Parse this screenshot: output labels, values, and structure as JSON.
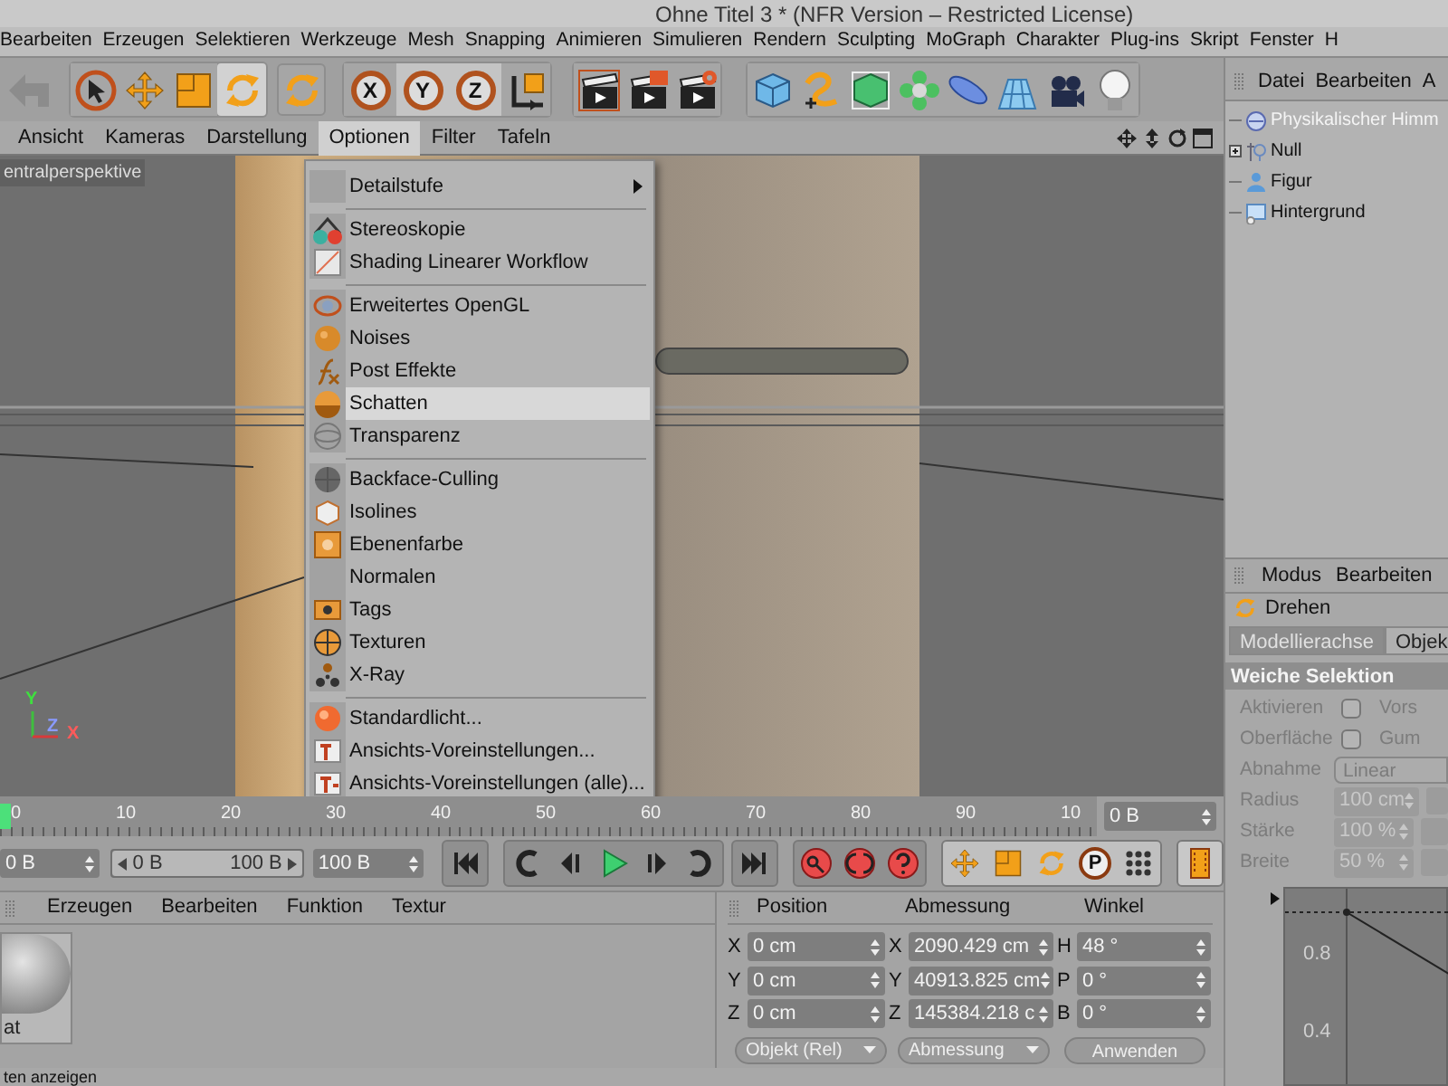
{
  "window": {
    "title": "Ohne Titel 3 * (NFR Version – Restricted License)"
  },
  "menubar": [
    "Bearbeiten",
    "Erzeugen",
    "Selektieren",
    "Werkzeuge",
    "Mesh",
    "Snapping",
    "Animieren",
    "Simulieren",
    "Rendern",
    "Sculpting",
    "MoGraph",
    "Charakter",
    "Plug-ins",
    "Skript",
    "Fenster",
    "H"
  ],
  "toolbar": {
    "tools": [
      {
        "selected": false
      },
      {
        "selected": false
      },
      {
        "selected": false
      },
      {
        "selected": true
      }
    ],
    "axis_locks": [
      {
        "label": "X",
        "on": false
      },
      {
        "label": "Y",
        "on": true
      },
      {
        "label": "Z",
        "on": true
      }
    ]
  },
  "viewport": {
    "menu": [
      {
        "label": "Ansicht",
        "selected": false
      },
      {
        "label": "Kameras",
        "selected": false
      },
      {
        "label": "Darstellung",
        "selected": false
      },
      {
        "label": "Optionen",
        "selected": true
      },
      {
        "label": "Filter",
        "selected": false
      },
      {
        "label": "Tafeln",
        "selected": false
      }
    ],
    "camera_label": "entralperspektive",
    "axes": [
      {
        "label": "Y",
        "color": "#3fdf3f"
      },
      {
        "label": "Z",
        "color": "#8a9aff"
      },
      {
        "label": "X",
        "color": "#ff5a5a"
      }
    ]
  },
  "options_menu": {
    "groups": [
      [
        {
          "label": "Detailstufe",
          "has_submenu": true,
          "selected": false
        }
      ],
      [
        {
          "label": "Stereoskopie",
          "selected": false
        },
        {
          "label": "Shading Linearer Workflow",
          "selected": false
        }
      ],
      [
        {
          "label": "Erweitertes OpenGL",
          "selected": false
        },
        {
          "label": "Noises",
          "selected": false
        },
        {
          "label": "Post Effekte",
          "selected": false
        },
        {
          "label": "Schatten",
          "selected": true
        },
        {
          "label": "Transparenz",
          "selected": false
        }
      ],
      [
        {
          "label": "Backface-Culling",
          "selected": false
        },
        {
          "label": "Isolines",
          "selected": false
        },
        {
          "label": "Ebenenfarbe",
          "selected": false
        },
        {
          "label": "Normalen",
          "selected": false
        },
        {
          "label": "Tags",
          "selected": false
        },
        {
          "label": "Texturen",
          "selected": false
        },
        {
          "label": "X-Ray",
          "selected": false
        }
      ],
      [
        {
          "label": "Standardlicht...",
          "selected": false
        },
        {
          "label": "Ansichts-Voreinstellungen...",
          "selected": false
        },
        {
          "label": "Ansichts-Voreinstellungen (alle)...",
          "selected": false
        }
      ]
    ]
  },
  "timeline": {
    "ticks": [
      "0",
      "10",
      "20",
      "30",
      "40",
      "50",
      "60",
      "70",
      "80",
      "90",
      "10"
    ],
    "current_frame": "0 B"
  },
  "transport": {
    "start": "0 B",
    "range_slider": {
      "start": "0 B",
      "end": "100 B",
      "level": 1
    },
    "end": "100 B",
    "keyframe_label": "P"
  },
  "material_manager": {
    "menu": [
      "Erzeugen",
      "Bearbeiten",
      "Funktion",
      "Textur"
    ],
    "materials": [
      {
        "name": "at"
      }
    ]
  },
  "coordinates": {
    "headers": [
      "Position",
      "Abmessung",
      "Winkel"
    ],
    "rows": [
      {
        "pos_axis": "X",
        "position": "0 cm",
        "size_axis": "X",
        "size": "2090.429 cm",
        "angle_axis": "H",
        "angle": "48 °"
      },
      {
        "pos_axis": "Y",
        "position": "0 cm",
        "size_axis": "Y",
        "size": "40913.825 cm",
        "angle_axis": "P",
        "angle": "0 °"
      },
      {
        "pos_axis": "Z",
        "position": "0 cm",
        "size_axis": "Z",
        "size": "145384.218 c",
        "angle_axis": "B",
        "angle": "0 °"
      }
    ],
    "mode": "Objekt (Rel)",
    "size_mode": "Abmessung",
    "apply": "Anwenden"
  },
  "object_manager": {
    "menu": [
      "Datei",
      "Bearbeiten",
      "A"
    ],
    "objects": [
      {
        "name": "Physikalischer Himm",
        "selected": true
      },
      {
        "name": "Null",
        "selected": false,
        "expanded": false
      },
      {
        "name": "Figur",
        "selected": false
      },
      {
        "name": "Hintergrund",
        "selected": false
      }
    ]
  },
  "attribute_manager": {
    "menu": [
      "Modus",
      "Bearbeiten"
    ],
    "tool": "Drehen",
    "tabs": [
      {
        "label": "Modellierachse",
        "selected": true
      },
      {
        "label": "Objek",
        "selected": false
      }
    ],
    "section": "Weiche Selektion",
    "rows": [
      {
        "kind": "checkbox",
        "label": "Aktivieren",
        "checked": false,
        "extra": "Vors",
        "disabled": true
      },
      {
        "kind": "checkbox",
        "label": "Oberfläche",
        "checked": false,
        "extra": "Gum",
        "disabled": true
      },
      {
        "kind": "dropdown",
        "label": "Abnahme",
        "value": "Linear",
        "disabled": true
      },
      {
        "kind": "number",
        "label": "Radius",
        "value": "100 cm",
        "disabled": true
      },
      {
        "kind": "number",
        "label": "Stärke",
        "value": "100 %",
        "disabled": true
      },
      {
        "kind": "number",
        "label": "Breite",
        "value": "50 %",
        "disabled": true
      }
    ],
    "graph_labels": [
      "0.8",
      "0.4"
    ]
  },
  "status_bar": {
    "text": "ten anzeigen"
  }
}
